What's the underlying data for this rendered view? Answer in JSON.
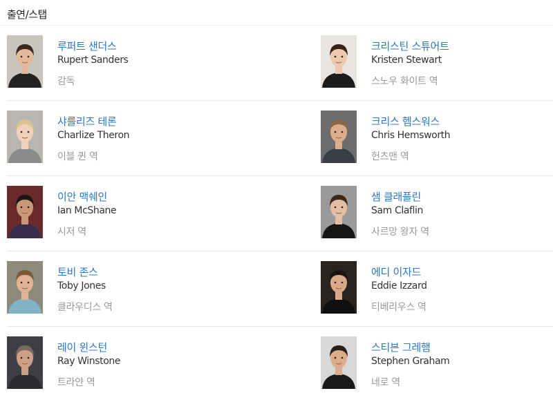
{
  "section": {
    "title": "출연/스탭"
  },
  "cast": [
    {
      "name_ko": "루퍼트 샌더스",
      "name_en": "Rupert Sanders",
      "role": "감독",
      "photo": {
        "bg": "#c9c4bd",
        "skin": "#e2b89a",
        "hair": "#3a2a20",
        "clothes": "#222222"
      }
    },
    {
      "name_ko": "크리스틴 스튜어트",
      "name_en": "Kristen Stewart",
      "role": "스노우 화이트 역",
      "photo": {
        "bg": "#e8e4df",
        "skin": "#edc9b1",
        "hair": "#3b2416",
        "clothes": "#1c1c1c"
      }
    },
    {
      "name_ko": "샤를리즈 테론",
      "name_en": "Charlize Theron",
      "role": "이블 퀸 역",
      "photo": {
        "bg": "#b9b6b2",
        "skin": "#efd2ba",
        "hair": "#d9c38c",
        "clothes": "#8a8a8a"
      }
    },
    {
      "name_ko": "크리스 헴스워스",
      "name_en": "Chris Hemsworth",
      "role": "헌츠맨 역",
      "photo": {
        "bg": "#6d6d70",
        "skin": "#dcae8d",
        "hair": "#8a6a44",
        "clothes": "#3a3d44"
      }
    },
    {
      "name_ko": "이안 맥쉐인",
      "name_en": "Ian McShane",
      "role": "시저 역",
      "photo": {
        "bg": "#6b2a2a",
        "skin": "#c9977a",
        "hair": "#1d1612",
        "clothes": "#3a2d4a"
      }
    },
    {
      "name_ko": "샘 클래플린",
      "name_en": "Sam Claflin",
      "role": "사르망 왕자 역",
      "photo": {
        "bg": "#9a9a9a",
        "skin": "#e4bea3",
        "hair": "#3b2a1c",
        "clothes": "#161616"
      }
    },
    {
      "name_ko": "토비 존스",
      "name_en": "Toby Jones",
      "role": "클라우디스 역",
      "photo": {
        "bg": "#8c8a7a",
        "skin": "#e0b396",
        "hair": "#7a5a36",
        "clothes": "#7fb3c5"
      }
    },
    {
      "name_ko": "에디 이자드",
      "name_en": "Eddie Izzard",
      "role": "티베리우스 역",
      "photo": {
        "bg": "#2a2420",
        "skin": "#d9a98a",
        "hair": "#1c1410",
        "clothes": "#101010"
      }
    },
    {
      "name_ko": "레이 윈스턴",
      "name_en": "Ray Winstone",
      "role": "트라얀 역",
      "photo": {
        "bg": "#3d3f43",
        "skin": "#cfa088",
        "hair": "#7a6b60",
        "clothes": "#2a2b2f"
      }
    },
    {
      "name_ko": "스티븐 그레햄",
      "name_en": "Stephen Graham",
      "role": "네로 역",
      "photo": {
        "bg": "#d8d8d8",
        "skin": "#dcab8c",
        "hair": "#2a2018",
        "clothes": "#1a1a1a"
      }
    }
  ]
}
